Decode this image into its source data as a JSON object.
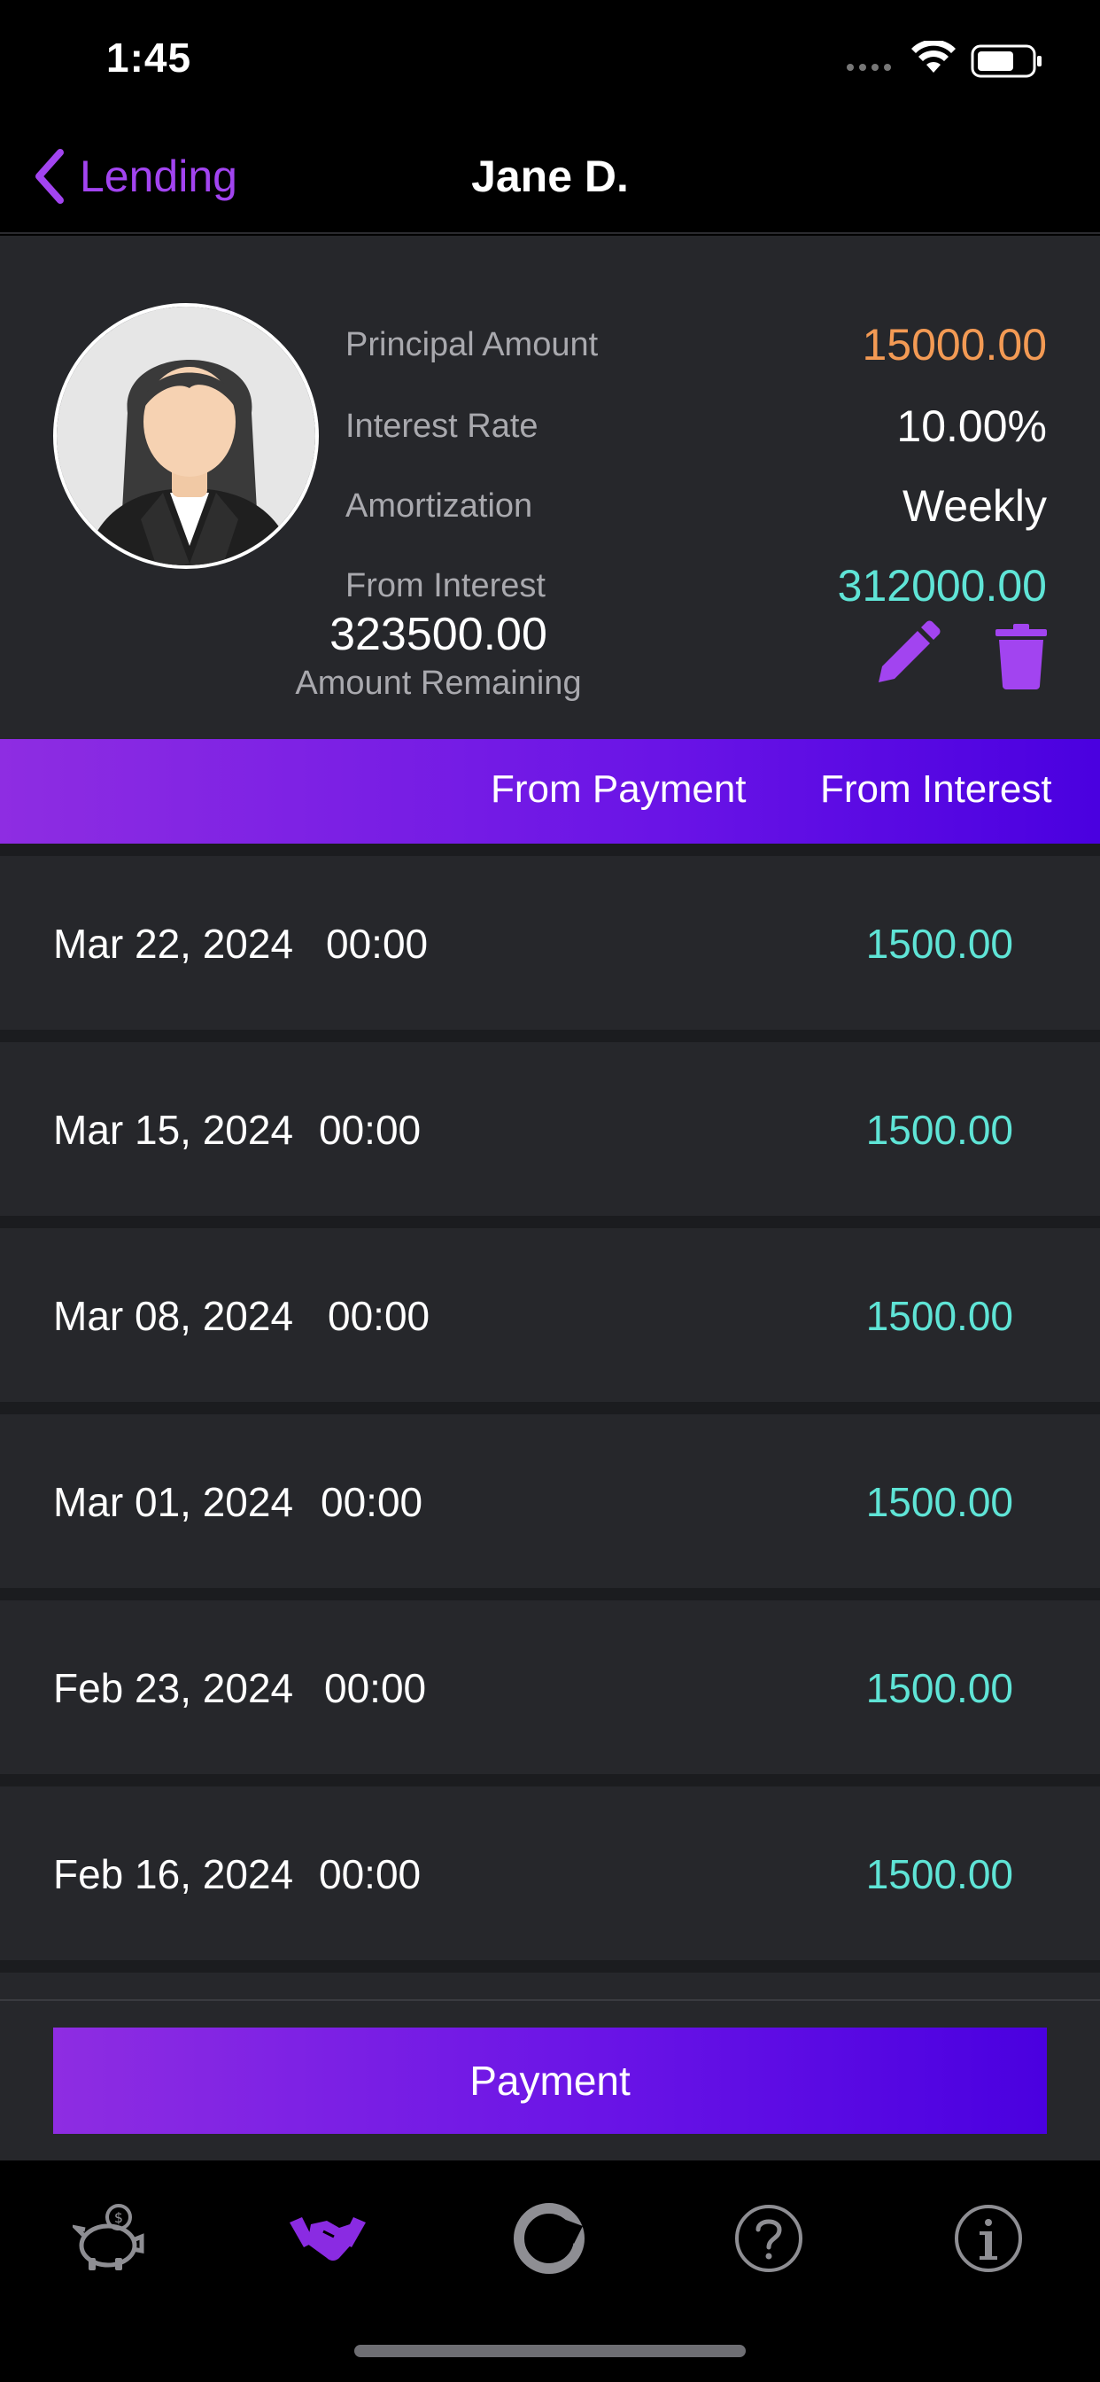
{
  "status_bar": {
    "time": "1:45"
  },
  "nav": {
    "back_label": "Lending",
    "title": "Jane D."
  },
  "summary": {
    "rows": [
      {
        "label": "Principal Amount",
        "value": "15000.00"
      },
      {
        "label": "Interest Rate",
        "value": "10.00%"
      },
      {
        "label": "Amortization",
        "value": "Weekly"
      },
      {
        "label": "From Interest",
        "value": "312000.00"
      }
    ],
    "remaining_value": "323500.00",
    "remaining_label": "Amount Remaining"
  },
  "columns": {
    "from_payment": "From Payment",
    "from_interest": "From Interest"
  },
  "payments": [
    {
      "date": "Mar 22, 2024",
      "time": "00:00",
      "amount": "1500.00"
    },
    {
      "date": "Mar 15, 2024",
      "time": "00:00",
      "amount": "1500.00"
    },
    {
      "date": "Mar 08, 2024",
      "time": "00:00",
      "amount": "1500.00"
    },
    {
      "date": "Mar 01, 2024",
      "time": "00:00",
      "amount": "1500.00"
    },
    {
      "date": "Feb 23, 2024",
      "time": "00:00",
      "amount": "1500.00"
    },
    {
      "date": "Feb 16, 2024",
      "time": "00:00",
      "amount": "1500.00"
    }
  ],
  "payment_button": {
    "label": "Payment"
  },
  "tabs": [
    {
      "icon": "piggy-bank-icon"
    },
    {
      "icon": "handshake-icon",
      "active": true
    },
    {
      "icon": "refresh-cycle-icon"
    },
    {
      "icon": "help-icon"
    },
    {
      "icon": "info-icon"
    }
  ],
  "colors": {
    "accent": "#a244f0",
    "gradient_start": "#8e2de2",
    "gradient_end": "#4a00e0",
    "principal": "#f39a54",
    "interest": "#5fe4d6",
    "card_bg": "#26272b"
  }
}
